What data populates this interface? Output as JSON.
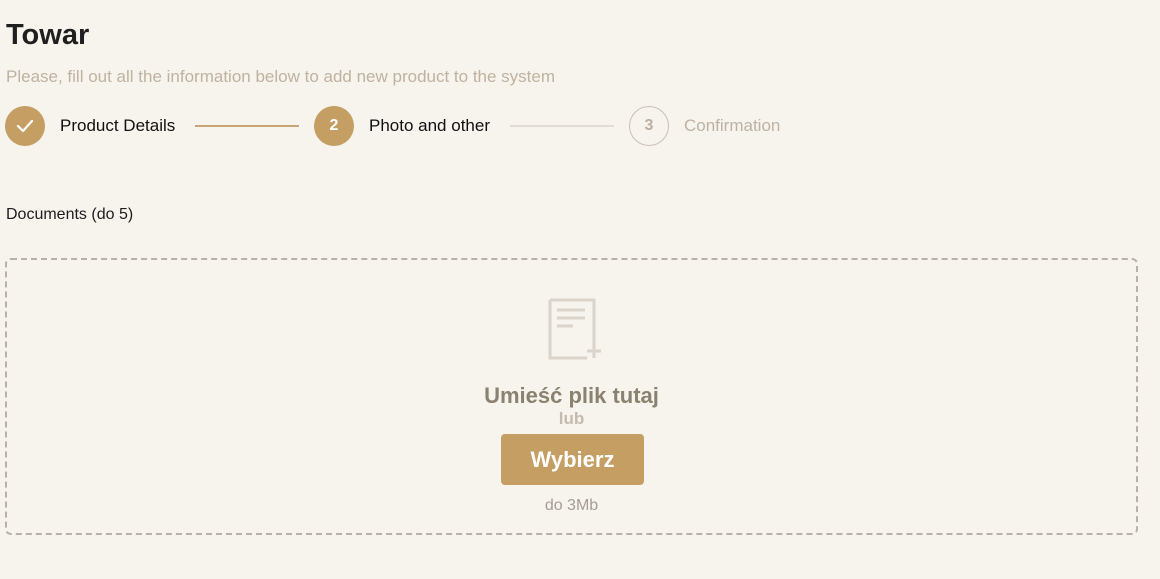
{
  "header": {
    "title": "Towar",
    "subtitle": "Please, fill out all the information below to add new product to the system"
  },
  "stepper": {
    "steps": [
      {
        "number": "",
        "label": "Product Details",
        "status": "done",
        "icon": "check-icon"
      },
      {
        "number": "2",
        "label": "Photo and other",
        "status": "active"
      },
      {
        "number": "3",
        "label": "Confirmation",
        "status": "pending"
      }
    ]
  },
  "documents": {
    "label": "Documents (do 5)",
    "dropzone": {
      "icon": "document-add-icon",
      "title": "Umieść plik tutaj",
      "or_text": "lub",
      "button_label": "Wybierz",
      "size_limit": "do 3Mb"
    }
  },
  "colors": {
    "accent": "#c49e62",
    "background": "#f7f3ed",
    "muted_text": "#bfb2a0",
    "dashed_border": "#b7b1a8"
  }
}
